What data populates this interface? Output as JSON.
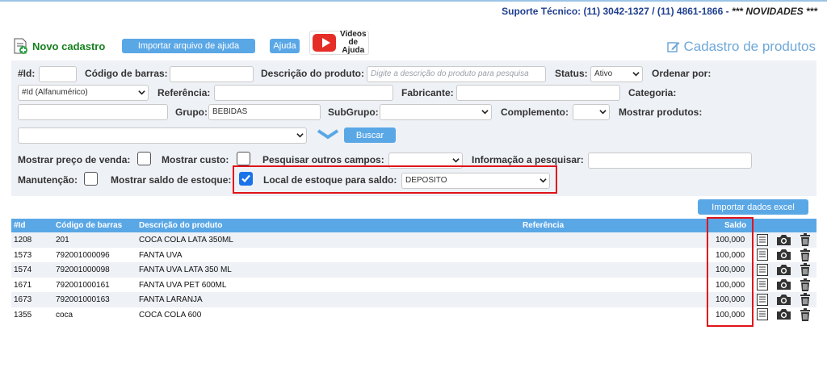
{
  "support": {
    "label": "Suporte Técnico: (11) 3042-1327 / (11) 4861-1866 -",
    "news": "*** NOVIDADES ***"
  },
  "header": {
    "new_label": "Novo cadastro",
    "import_help_label": "Importar arquivo de ajuda",
    "help_label": "Ajuda",
    "videos_label_1": "Videos",
    "videos_label_2": "de Ajuda",
    "youtube_label": "YouTube",
    "page_title": "Cadastro de produtos"
  },
  "filters": {
    "id_label": "#Id:",
    "barcode_label": "Código de barras:",
    "desc_label": "Descrição do produto:",
    "desc_placeholder": "Digite a descrição do produto para pesquisa",
    "status_label": "Status:",
    "status_value": "Ativo",
    "order_label": "Ordenar por:",
    "order_value": "#Id (Alfanumérico)",
    "ref_label": "Referência:",
    "maker_label": "Fabricante:",
    "category_label": "Categoria:",
    "group_label": "Grupo:",
    "group_value": "BEBIDAS",
    "subgroup_label": "SubGrupo:",
    "complement_label": "Complemento:",
    "show_products_label": "Mostrar produtos:",
    "search_label": "Buscar",
    "show_price_label": "Mostrar preço de venda:",
    "show_cost_label": "Mostrar custo:",
    "search_other_label": "Pesquisar outros campos:",
    "info_label": "Informação a pesquisar:",
    "maintenance_label": "Manutenção:",
    "show_stock_label": "Mostrar saldo de estoque:",
    "show_stock_checked": true,
    "stock_location_label": "Local de estoque para saldo:",
    "stock_location_value": "DEPOSITO"
  },
  "import_excel_label": "Importar dados excel",
  "table": {
    "headers": {
      "id": "#Id",
      "barcode": "Código de barras",
      "desc": "Descrição do produto",
      "ref": "Referência",
      "saldo": "Saldo"
    },
    "rows": [
      {
        "id": "1208",
        "barcode": "201",
        "desc": "COCA COLA LATA 350ML",
        "ref": "",
        "saldo": "100,000"
      },
      {
        "id": "1573",
        "barcode": "792001000096",
        "desc": "FANTA UVA",
        "ref": "",
        "saldo": "100,000"
      },
      {
        "id": "1574",
        "barcode": "792001000098",
        "desc": "FANTA UVA LATA 350 ML",
        "ref": "",
        "saldo": "100,000"
      },
      {
        "id": "1671",
        "barcode": "792001000161",
        "desc": "FANTA UVA PET 600ML",
        "ref": "",
        "saldo": "100,000"
      },
      {
        "id": "1673",
        "barcode": "792001000163",
        "desc": "FANTA LARANJA",
        "ref": "",
        "saldo": "100,000"
      },
      {
        "id": "1355",
        "barcode": "coca",
        "desc": "COCA COLA 600",
        "ref": "",
        "saldo": "100,000"
      }
    ]
  },
  "colors": {
    "accent": "#5aa7e6",
    "highlight": "#e0131a",
    "new": "#16801e"
  }
}
